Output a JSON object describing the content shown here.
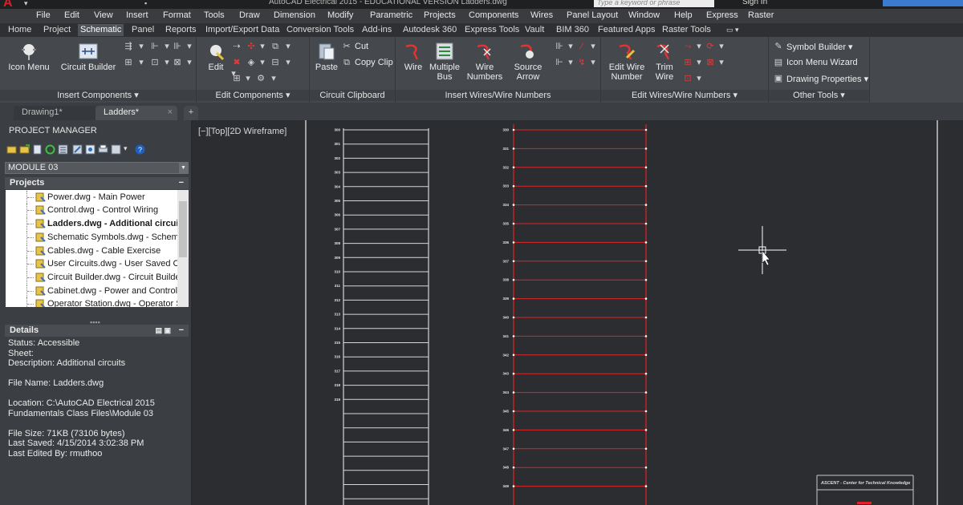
{
  "window": {
    "title": "AutoCAD Electrical 2015 - EDUCATIONAL VERSION    Ladders.dwg",
    "search_placeholder": "Type a keyword or phrase",
    "sign_in": "Sign In"
  },
  "menubar": [
    "File",
    "Edit",
    "View",
    "Insert",
    "Format",
    "Tools",
    "Draw",
    "Dimension",
    "Modify",
    "Parametric",
    "Projects",
    "Components",
    "Wires",
    "Panel Layout",
    "Window",
    "Help",
    "Express",
    "Raster"
  ],
  "ribbon_tabs": [
    "Home",
    "Project",
    "Schematic",
    "Panel",
    "Reports",
    "Import/Export Data",
    "Conversion Tools",
    "Add-ins",
    "Autodesk 360",
    "Express Tools",
    "Vault",
    "BIM 360",
    "Featured Apps",
    "Raster Tools"
  ],
  "ribbon": {
    "insert_components": {
      "label": "Insert Components",
      "icon_menu": "Icon Menu",
      "circuit_builder": "Circuit Builder"
    },
    "edit_components": {
      "label": "Edit Components",
      "edit": "Edit"
    },
    "circuit_clipboard": {
      "label": "Circuit Clipboard",
      "paste": "Paste",
      "cut": "Cut",
      "copy_clip": "Copy Clip"
    },
    "insert_wires": {
      "label": "Insert Wires/Wire Numbers",
      "wire": "Wire",
      "multiple_bus_1": "Multiple",
      "multiple_bus_2": "Bus",
      "wire_numbers_1": "Wire",
      "wire_numbers_2": "Numbers",
      "source_arrow_1": "Source",
      "source_arrow_2": "Arrow"
    },
    "edit_wires": {
      "label": "Edit Wires/Wire Numbers",
      "edit_wire_number_1": "Edit Wire",
      "edit_wire_number_2": "Number",
      "trim_wire_1": "Trim",
      "trim_wire_2": "Wire"
    },
    "other_tools": {
      "label": "Other Tools",
      "symbol_builder": "Symbol Builder",
      "icon_menu_wizard": "Icon Menu  Wizard",
      "drawing_properties": "Drawing  Properties"
    }
  },
  "doc_tabs": [
    "Drawing1*",
    "Ladders*"
  ],
  "project_manager": {
    "title": "PROJECT MANAGER",
    "module": "MODULE 03",
    "projects_header": "Projects",
    "details_header": "Details",
    "projects": [
      "Power.dwg - Main Power",
      "Control.dwg - Control Wiring",
      "Ladders.dwg - Additional circuits",
      "Schematic Symbols.dwg - Schematic",
      "Cables.dwg - Cable Exercise",
      "User Circuits.dwg - User Saved Circuit",
      "Circuit Builder.dwg - Circuit Builder E",
      "Cabinet.dwg - Power and Control",
      "Operator Station.dwg - Operator Stat"
    ],
    "details": [
      "Status: Accessible",
      "Sheet:",
      "Description: Additional circuits",
      "",
      "File Name: Ladders.dwg",
      "",
      "Location: C:\\AutoCAD Electrical 2015",
      "Fundamentals Class Files\\Module 03",
      "",
      "File Size: 71KB (73106 bytes)",
      "Last Saved: 4/15/2014 3:02:38 PM",
      "Last Edited By: rmuthoo"
    ]
  },
  "canvas": {
    "viewport_label": "[−][Top][2D Wireframe]",
    "ladder1_refs": [
      "300",
      "301",
      "302",
      "303",
      "304",
      "305",
      "306",
      "307",
      "308",
      "309",
      "310",
      "311",
      "312",
      "313",
      "314",
      "315",
      "316",
      "317",
      "318",
      "319"
    ],
    "ladder2_refs": [
      "330",
      "331",
      "332",
      "333",
      "334",
      "335",
      "336",
      "337",
      "338",
      "339",
      "340",
      "341",
      "342",
      "343",
      "344",
      "345",
      "346",
      "347",
      "348",
      "349"
    ],
    "title_block_text": "ASCENT - Center for Technical Knowledge"
  },
  "colors": {
    "ladder_white": "#d6d6d6",
    "ladder_red": "#e02424",
    "canvas_bg": "#2b2d30"
  }
}
